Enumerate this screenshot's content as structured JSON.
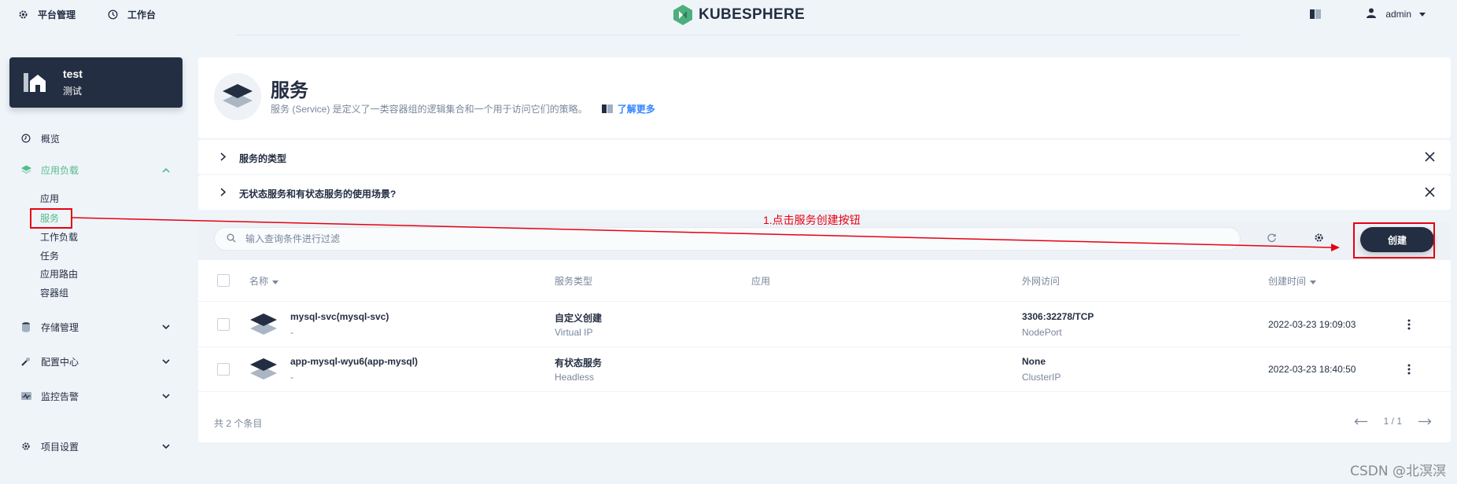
{
  "topbar": {
    "platform_label": "平台管理",
    "workbench_label": "工作台",
    "logo_text": "KUBESPHERE",
    "user_name": "admin"
  },
  "project": {
    "name": "test",
    "alias": "测试"
  },
  "sidebar": {
    "overview": "概览",
    "workloads": "应用负载",
    "sub_items": [
      "应用",
      "服务",
      "工作负载",
      "任务",
      "应用路由",
      "容器组"
    ],
    "storage": "存储管理",
    "config": "配置中心",
    "monitoring": "监控告警",
    "settings": "项目设置"
  },
  "page": {
    "title": "服务",
    "description": "服务 (Service) 是定义了一类容器组的逻辑集合和一个用于访问它们的策略。",
    "learn_more": "了解更多"
  },
  "faq": [
    "服务的类型",
    "无状态服务和有状态服务的使用场景?"
  ],
  "toolbar": {
    "search_placeholder": "输入查询条件进行过滤",
    "create_label": "创建"
  },
  "table": {
    "columns": [
      "名称",
      "服务类型",
      "应用",
      "外网访问",
      "创建时间"
    ],
    "rows": [
      {
        "name": "mysql-svc(mysql-svc)",
        "desc": "-",
        "type": "自定义创建",
        "type_sub": "Virtual IP",
        "app": "",
        "access": "3306:32278/TCP",
        "access_sub": "NodePort",
        "created": "2022-03-23 19:09:03"
      },
      {
        "name": "app-mysql-wyu6(app-mysql)",
        "desc": "-",
        "type": "有状态服务",
        "type_sub": "Headless",
        "app": "",
        "access": "None",
        "access_sub": "ClusterIP",
        "created": "2022-03-23 18:40:50"
      }
    ],
    "total": "共 2 个条目",
    "pages": "1 / 1"
  },
  "annotation": "1.点击服务创建按钮",
  "watermark": "CSDN @北溟溟",
  "colors": {
    "accent": "#55bc8a",
    "dark": "#242e42",
    "annotation": "#e60012",
    "link": "#3385ff"
  }
}
